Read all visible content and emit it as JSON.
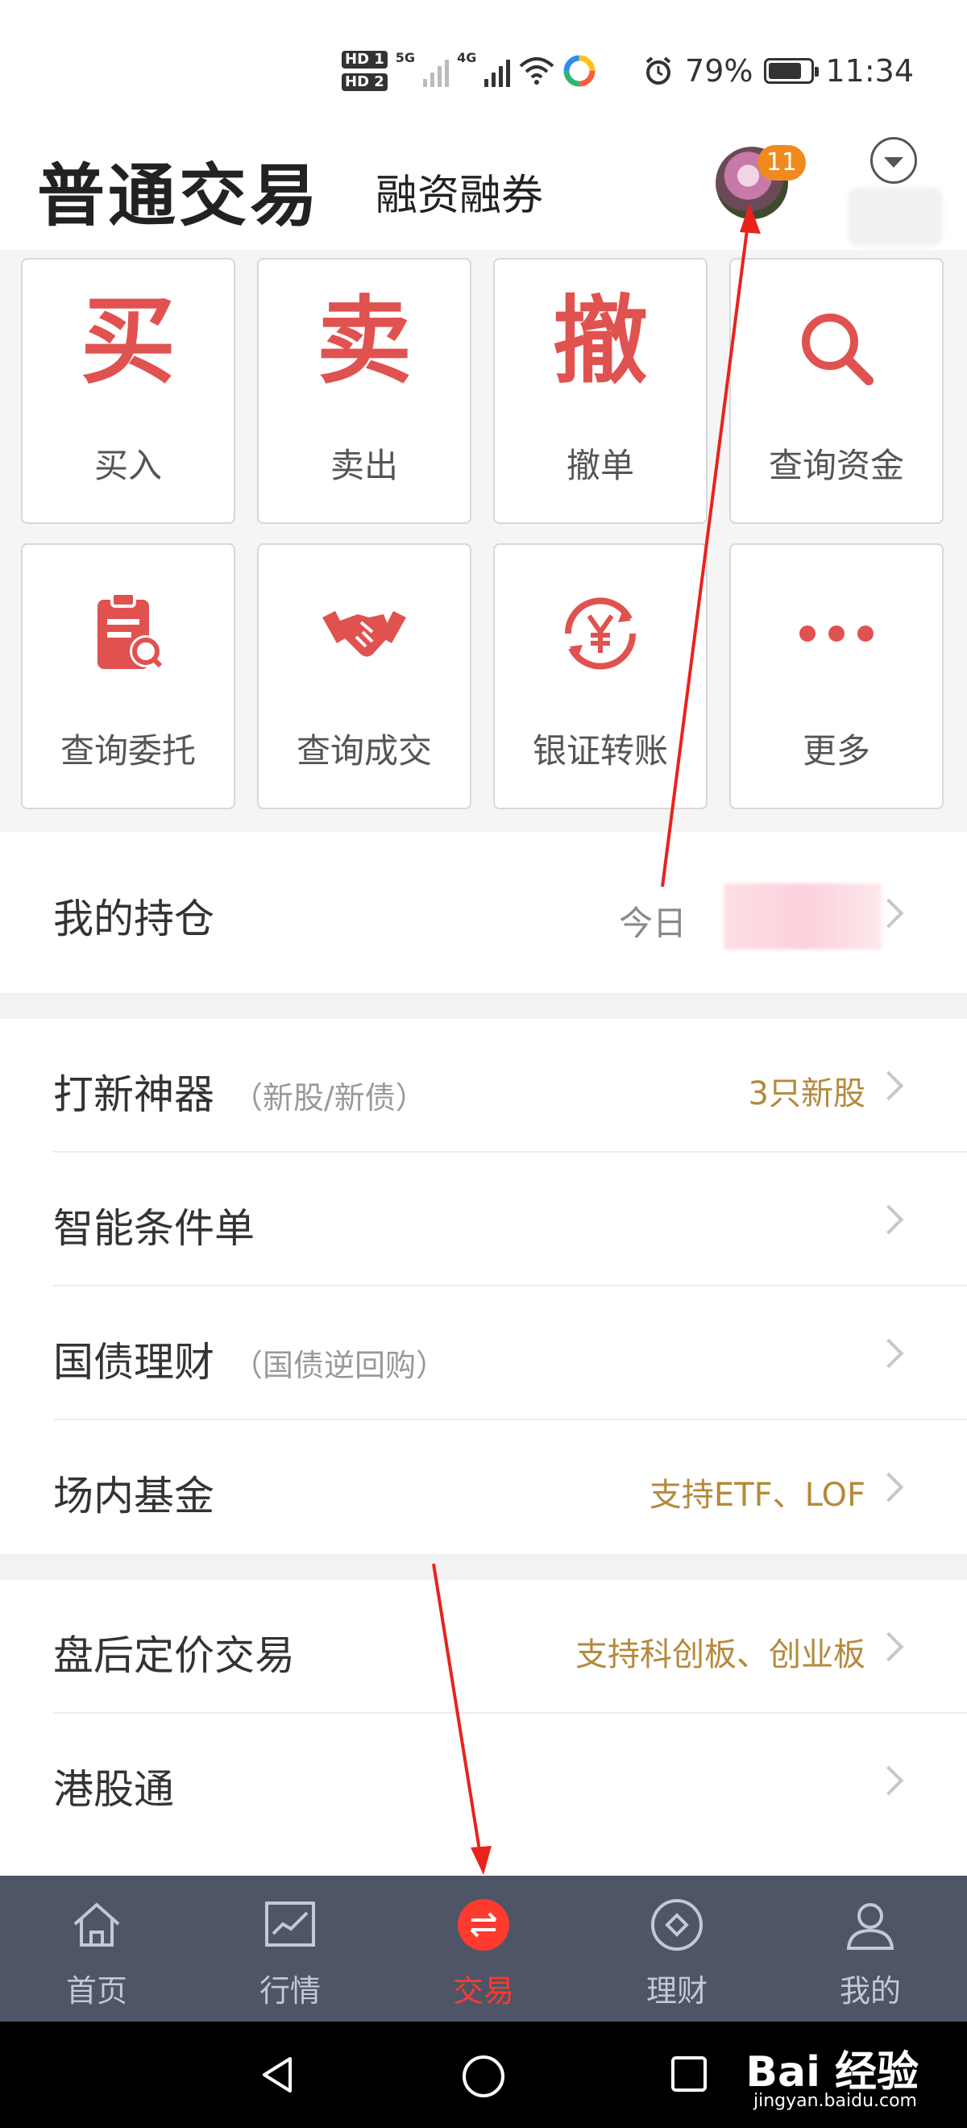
{
  "status_bar": {
    "hd1": "HD 1",
    "hd2": "HD 2",
    "net1": "5G",
    "net2": "4G",
    "battery_percent": "79%",
    "battery_level": 0.79,
    "time": "11:34"
  },
  "header": {
    "title": "普通交易",
    "tab_margin": "融资融券",
    "notification_count": "11"
  },
  "grid": [
    {
      "glyph": "买",
      "label": "买入"
    },
    {
      "glyph": "卖",
      "label": "卖出"
    },
    {
      "glyph": "撤",
      "label": "撤单"
    },
    {
      "icon": "search-icon",
      "label": "查询资金"
    },
    {
      "icon": "clipboard-search-icon",
      "label": "查询委托"
    },
    {
      "icon": "handshake-icon",
      "label": "查询成交"
    },
    {
      "icon": "yen-transfer-icon",
      "label": "银证转账"
    },
    {
      "icon": "more-dots-icon",
      "label": "更多"
    }
  ],
  "holdings": {
    "label": "我的持仓",
    "today_label": "今日"
  },
  "list_section_1": [
    {
      "label": "打新神器",
      "sub": "（新股/新债）",
      "value": "3只新股"
    },
    {
      "label": "智能条件单",
      "sub": "",
      "value": ""
    },
    {
      "label": "国债理财",
      "sub": "（国债逆回购）",
      "value": ""
    },
    {
      "label": "场内基金",
      "sub": "",
      "value": "支持ETF、LOF"
    }
  ],
  "list_section_2": [
    {
      "label": "盘后定价交易",
      "sub": "",
      "value": "支持科创板、创业板"
    },
    {
      "label": "港股通",
      "sub": "",
      "value": ""
    }
  ],
  "bottom_nav": [
    {
      "label": "首页",
      "icon": "home-icon"
    },
    {
      "label": "行情",
      "icon": "chart-icon"
    },
    {
      "label": "交易",
      "icon": "exchange-icon",
      "active": true
    },
    {
      "label": "理财",
      "icon": "diamond-icon"
    },
    {
      "label": "我的",
      "icon": "user-icon"
    }
  ],
  "watermark": {
    "brand": "Bai 经验",
    "url": "jingyan.baidu.com"
  },
  "colors": {
    "accent_red": "#e0524f",
    "active_red": "#ff3a2f",
    "gold_text": "#b48a3a",
    "nav_bg": "#4d5566",
    "badge_orange": "#f08a20"
  }
}
